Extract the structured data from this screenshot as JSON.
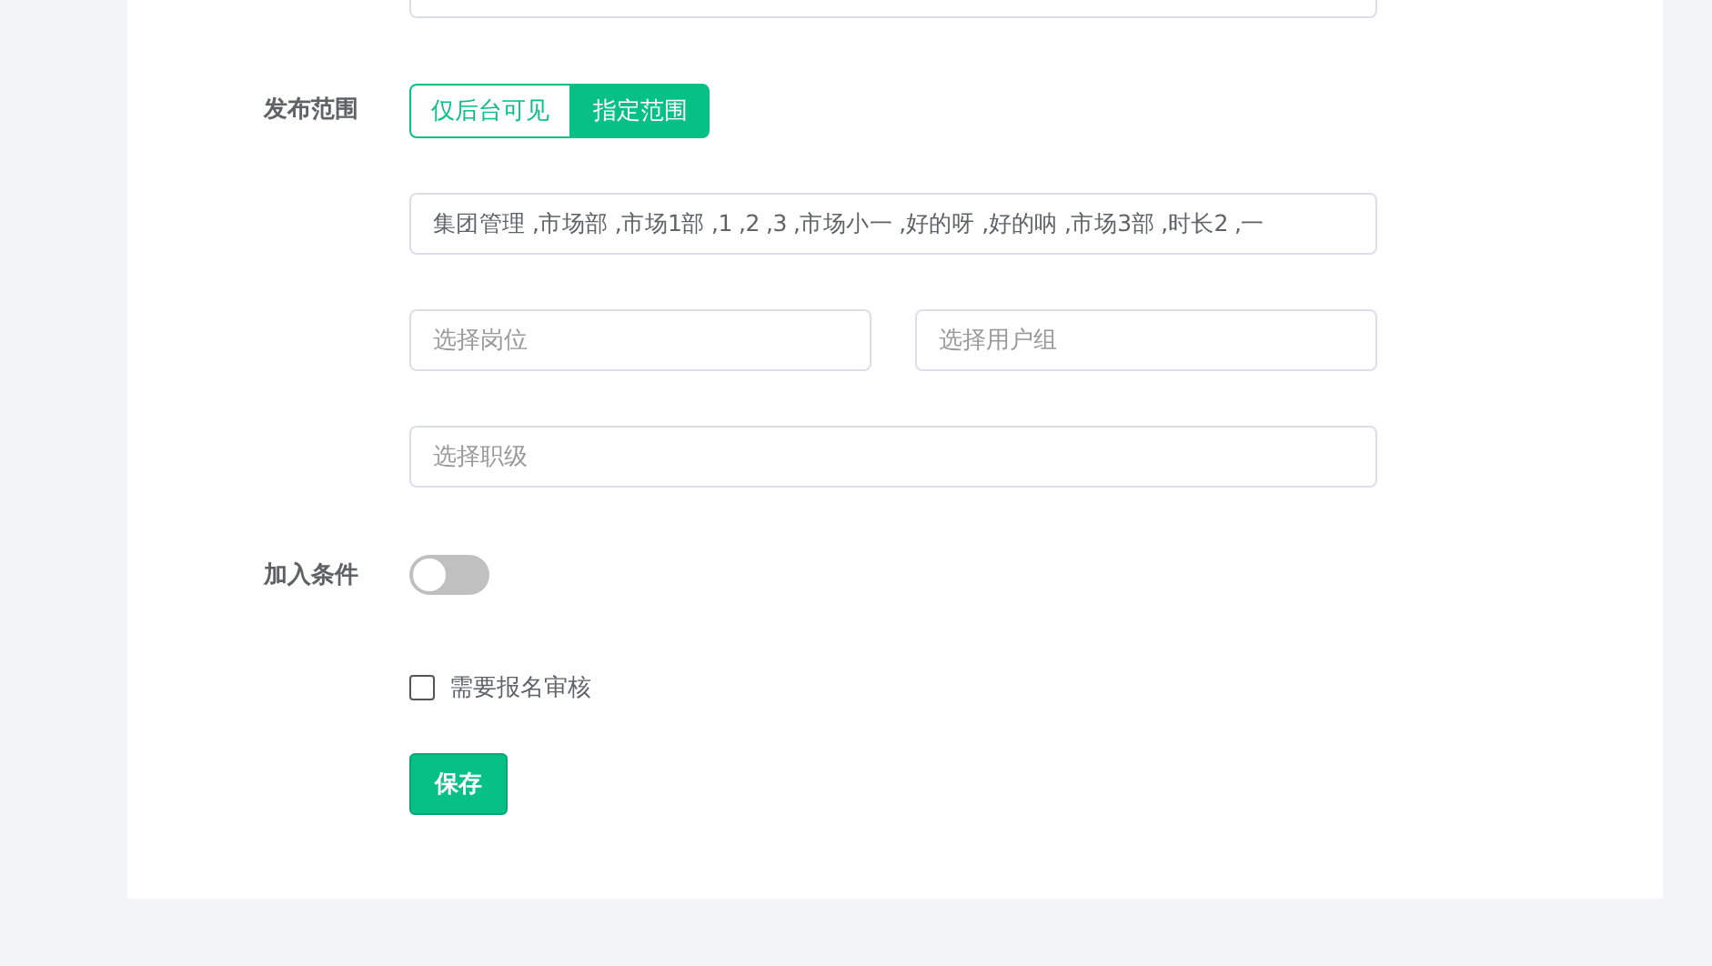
{
  "scope": {
    "label": "发布范围",
    "options": [
      {
        "label": "仅后台可见",
        "selected": false
      },
      {
        "label": "指定范围",
        "selected": true
      }
    ],
    "departments": {
      "value": "集团管理 ,市场部 ,市场1部 ,1 ,2 ,3 ,市场小一 ,好的呀 ,好的呐 ,市场3部 ,时长2 ,一"
    },
    "position": {
      "placeholder": "选择岗位"
    },
    "user_group": {
      "placeholder": "选择用户组"
    },
    "rank": {
      "placeholder": "选择职级"
    }
  },
  "join_condition": {
    "label": "加入条件",
    "on": false
  },
  "review": {
    "label": "需要报名审核",
    "checked": false
  },
  "save_button": "保存"
}
